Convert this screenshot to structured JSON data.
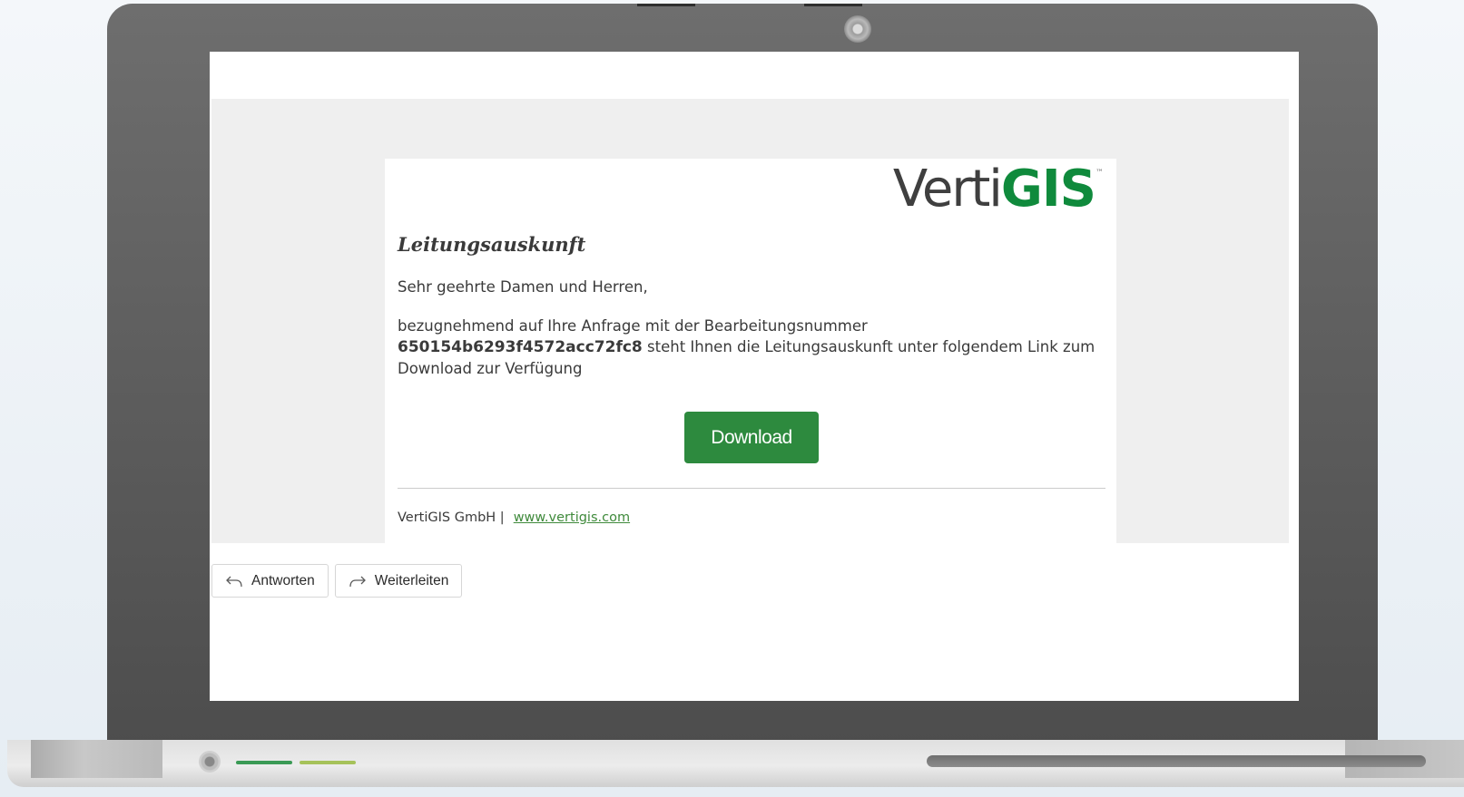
{
  "email": {
    "logo": {
      "text_main": "Verti",
      "text_accent": "GIS",
      "trademark": "™",
      "accent_color": "#0f8a3c"
    },
    "heading": "Leitungsauskunft",
    "greeting": "Sehr geehrte Damen und Herren,",
    "body_before_ref": "bezugnehmend auf Ihre Anfrage mit der Bearbeitungsnummer",
    "reference_number": "650154b6293f4572acc72fc8",
    "body_after_ref": "steht Ihnen die Leitungsauskunft unter folgendem Link zum Download zur Verfügung",
    "download_button_label": "Download",
    "button_color": "#2d8a3e",
    "footer": {
      "company": "VertiGIS GmbH |",
      "link_text": "www.vertigis.com",
      "link_color": "#3f8a3b"
    }
  },
  "actions": {
    "reply_label": "Antworten",
    "reply_icon": "reply-arrow-icon",
    "forward_label": "Weiterleiten",
    "forward_icon": "forward-arrow-icon"
  },
  "device": {
    "led_colors": [
      "#3a9a55",
      "#a6c25a"
    ]
  }
}
